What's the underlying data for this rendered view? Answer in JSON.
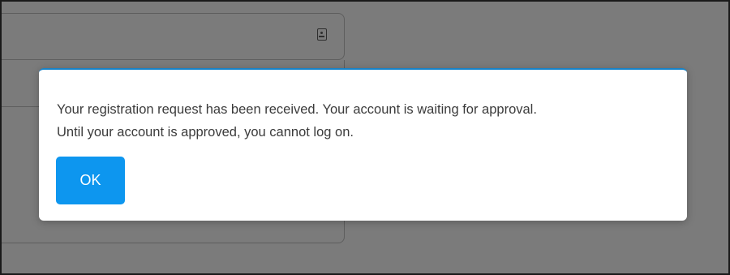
{
  "dialog": {
    "message_line1": "Your registration request has been received. Your account is waiting for approval.",
    "message_line2": "Until your account is approved, you cannot log on.",
    "ok_label": "OK"
  },
  "colors": {
    "overlay": "#7b7b7b",
    "dialog_background": "#ffffff",
    "dialog_accent": "#1683c9",
    "button_background": "#0d96ef",
    "button_text": "#ffffff",
    "message_text": "#3b3b3b"
  },
  "icons": {
    "background_field_icon": "contact-card-icon"
  }
}
